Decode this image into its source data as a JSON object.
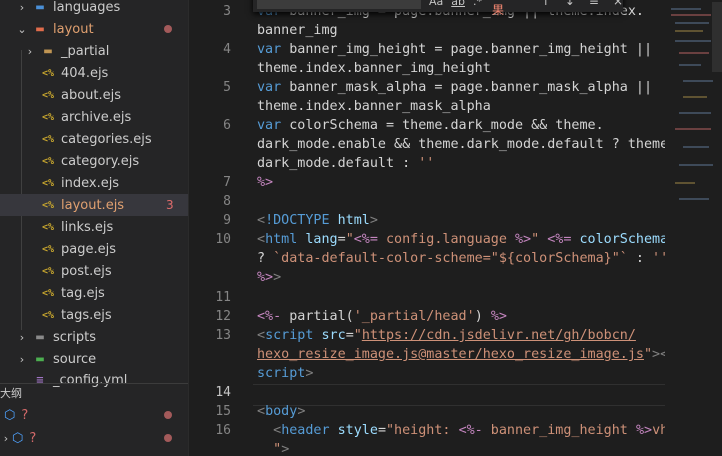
{
  "explorer": {
    "items": [
      {
        "label": "languages",
        "kind": "folder",
        "expanded": false,
        "depth": 1
      },
      {
        "label": "layout",
        "kind": "folder",
        "expanded": true,
        "depth": 1
      },
      {
        "label": "_partial",
        "kind": "folder",
        "expanded": false,
        "depth": 2
      },
      {
        "label": "404.ejs",
        "kind": "ejs",
        "depth": 2
      },
      {
        "label": "about.ejs",
        "kind": "ejs",
        "depth": 2
      },
      {
        "label": "archive.ejs",
        "kind": "ejs",
        "depth": 2
      },
      {
        "label": "categories.ejs",
        "kind": "ejs",
        "depth": 2
      },
      {
        "label": "category.ejs",
        "kind": "ejs",
        "depth": 2
      },
      {
        "label": "index.ejs",
        "kind": "ejs",
        "depth": 2
      },
      {
        "label": "layout.ejs",
        "kind": "ejs",
        "depth": 2,
        "badge": "3"
      },
      {
        "label": "links.ejs",
        "kind": "ejs",
        "depth": 2
      },
      {
        "label": "page.ejs",
        "kind": "ejs",
        "depth": 2
      },
      {
        "label": "post.ejs",
        "kind": "ejs",
        "depth": 2
      },
      {
        "label": "tag.ejs",
        "kind": "ejs",
        "depth": 2
      },
      {
        "label": "tags.ejs",
        "kind": "ejs",
        "depth": 2
      },
      {
        "label": "scripts",
        "kind": "folder",
        "expanded": false,
        "depth": 1
      },
      {
        "label": "source",
        "kind": "folder",
        "expanded": false,
        "depth": 1
      },
      {
        "label": "_config.yml",
        "kind": "yml",
        "depth": 1
      }
    ],
    "ejs_icon": "<%",
    "outline_title": "大纲",
    "outline": [
      {
        "label": "?"
      },
      {
        "label": "?"
      }
    ]
  },
  "find_widget": {
    "opt_case": "Aa",
    "opt_word": "ab",
    "opt_regex": ".*",
    "result": "无结果",
    "up": "↑",
    "down": "↓",
    "selection": "≡",
    "close": "×"
  },
  "editor": {
    "line_numbers": [
      "3",
      "",
      "4",
      "",
      "5",
      "",
      "6",
      "",
      "",
      "7",
      "8",
      "9",
      "10",
      "",
      "",
      "11",
      "12",
      "13",
      "",
      "",
      "14",
      "15",
      "16",
      ""
    ],
    "current_line": "14"
  }
}
